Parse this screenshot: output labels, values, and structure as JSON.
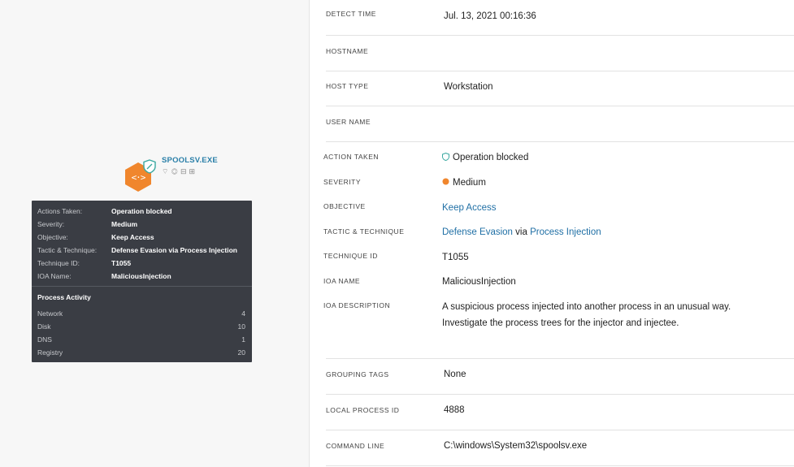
{
  "graph": {
    "process_name": "SPOOLSV.EXE",
    "node_icon": "code-brackets-icon",
    "badge_icon": "shield-icon",
    "tooltip": {
      "rows": [
        {
          "key": "Actions Taken:",
          "value": "Operation blocked"
        },
        {
          "key": "Severity:",
          "value": "Medium"
        },
        {
          "key": "Objective:",
          "value": "Keep Access"
        },
        {
          "key": "Tactic & Technique:",
          "value": "Defense Evasion via Process Injection"
        },
        {
          "key": "Technique ID:",
          "value": "T1055"
        },
        {
          "key": "IOA Name:",
          "value": "MaliciousInjection"
        }
      ],
      "activity_title": "Process Activity",
      "activity": [
        {
          "label": "Network",
          "count": "4"
        },
        {
          "label": "Disk",
          "count": "10"
        },
        {
          "label": "DNS",
          "count": "1"
        },
        {
          "label": "Registry",
          "count": "20"
        }
      ]
    }
  },
  "details": {
    "detect_time": {
      "label": "DETECT TIME",
      "value": "Jul. 13, 2021 00:16:36"
    },
    "hostname": {
      "label": "HOSTNAME",
      "value": ""
    },
    "host_type": {
      "label": "HOST TYPE",
      "value": "Workstation"
    },
    "user_name": {
      "label": "USER NAME",
      "value": ""
    },
    "action_taken": {
      "label": "ACTION TAKEN",
      "value": "Operation blocked"
    },
    "severity": {
      "label": "SEVERITY",
      "value": "Medium",
      "color": "#f0862d"
    },
    "objective": {
      "label": "OBJECTIVE",
      "value": "Keep Access"
    },
    "tactic": {
      "label": "TACTIC & TECHNIQUE",
      "tactic": "Defense Evasion",
      "via": "via",
      "technique": "Process Injection"
    },
    "technique_id": {
      "label": "TECHNIQUE ID",
      "value": "T1055"
    },
    "ioa_name": {
      "label": "IOA NAME",
      "value": "MaliciousInjection"
    },
    "ioa_description": {
      "label": "IOA DESCRIPTION",
      "value": "A suspicious process injected into another process in an unusual way. Investigate the process trees for the injector and injectee."
    },
    "grouping_tags": {
      "label": "GROUPING TAGS",
      "value": "None"
    },
    "local_process_id": {
      "label": "LOCAL PROCESS ID",
      "value": "4888"
    },
    "command_line": {
      "label": "COMMAND LINE",
      "value": "C:\\windows\\System32\\spoolsv.exe"
    }
  },
  "colors": {
    "accent_orange": "#f0862d",
    "link_blue": "#1f6fa5",
    "badge_teal": "#3aa8a0",
    "tooltip_bg": "#3a3d44"
  }
}
